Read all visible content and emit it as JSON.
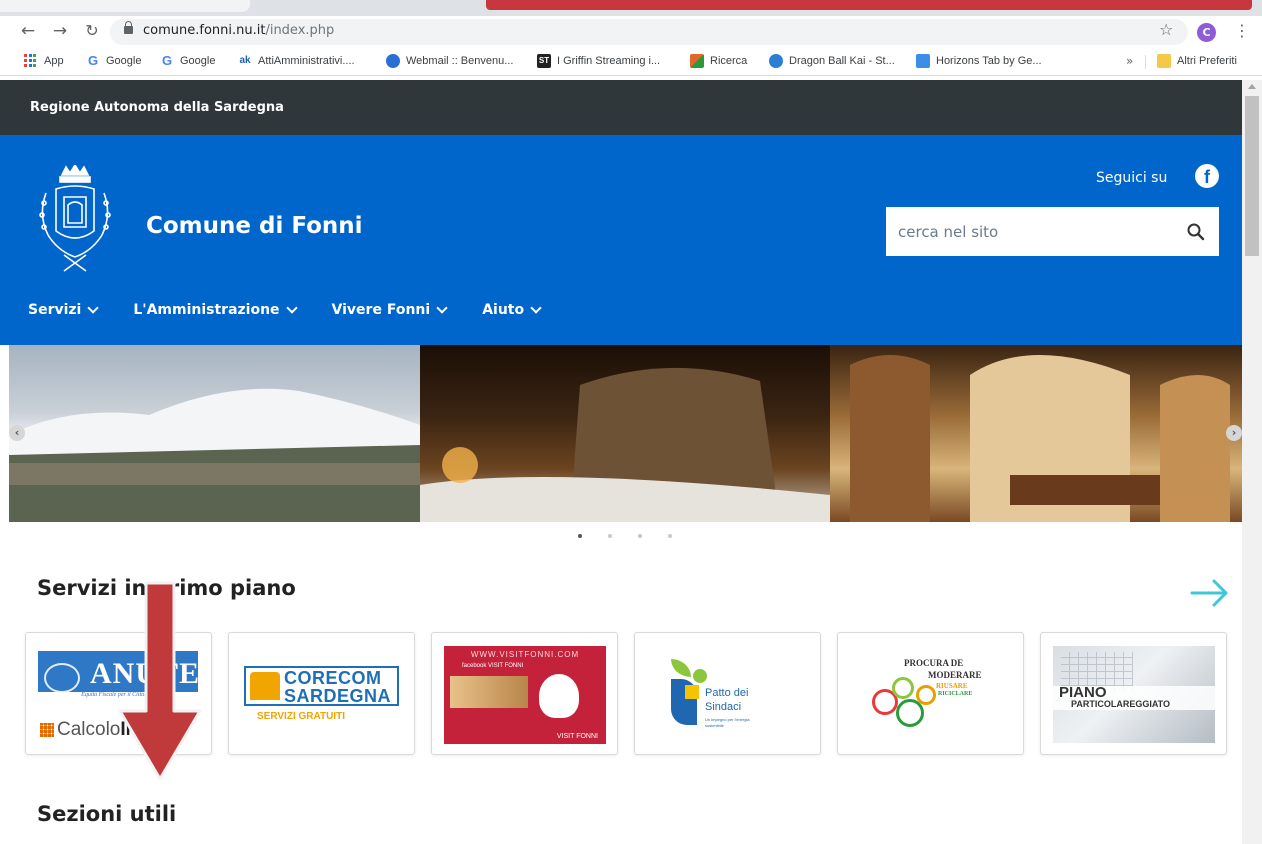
{
  "browser": {
    "url_host": "comune.fonni.nu.it",
    "url_path": "/index.php",
    "profile_initial": "C",
    "bookmarks": [
      {
        "label": "App",
        "icon": "apps-grid-icon"
      },
      {
        "label": "Google",
        "icon": "google-icon",
        "color": "#4285f4"
      },
      {
        "label": "Google",
        "icon": "google-icon",
        "color": "#4285f4"
      },
      {
        "label": "AttiAmministrativi....",
        "icon": "atti-icon",
        "color": "#1a5fb4"
      },
      {
        "label": "Webmail :: Benvenu...",
        "icon": "webmail-icon",
        "color": "#2a6fd6"
      },
      {
        "label": "I Griffin Streaming i...",
        "icon": "st-icon",
        "color": "#222222"
      },
      {
        "label": "Ricerca",
        "icon": "ricerca-icon",
        "color": "#e0682a"
      },
      {
        "label": "Dragon Ball Kai - St...",
        "icon": "dragonball-icon",
        "color": "#2a7fd4"
      },
      {
        "label": "Horizons Tab by Ge...",
        "icon": "horizons-icon",
        "color": "#3a8ee6"
      }
    ],
    "bookmarks_overflow": "»",
    "other_bookmarks": "Altri Preferiti"
  },
  "site": {
    "region": "Regione Autonoma della Sardegna",
    "title": "Comune di Fonni",
    "follow_label": "Seguici su",
    "search_placeholder": "cerca nel sito",
    "nav": [
      "Servizi",
      "L'Amministrazione",
      "Vivere Fonni",
      "Aiuto"
    ],
    "carousel_slides": 4,
    "carousel_active": 1,
    "section_featured": "Servizi in primo piano",
    "section_useful": "Sezioni utili",
    "cards": [
      {
        "name": "anutel",
        "logo_text": "ANUTEL",
        "tagline": "Equità Fiscale per il Cittadino",
        "sub": "Calcolo",
        "sub_bold": "IMU",
        "sub_tail": "20"
      },
      {
        "name": "corecom",
        "line1": "CORECOM",
        "line2": "SARDEGNA",
        "sub": "SERVIZI GRATUITI"
      },
      {
        "name": "visit-fonni",
        "url_text": "WWW.VISITFONNI.COM",
        "fb_text": "facebook  VISIT FONNI",
        "footer": "VISIT FONNI"
      },
      {
        "name": "patto-sindaci",
        "line1": "Patto dei",
        "line2": "Sindaci",
        "line3": "Un impegno per l'energia sostenibile"
      },
      {
        "name": "procura-moderare",
        "line1": "PROCURA DE",
        "line2": "MODERARE",
        "line3": "RIUSARE",
        "line4": "RICICLARE"
      },
      {
        "name": "piano-particolareggiato",
        "line1": "PIANO",
        "line2": "PARTICOLAREGGIATO"
      }
    ]
  },
  "colors": {
    "header_blue": "#0066cc",
    "region_bar": "#30373b",
    "accent_teal": "#3cc8d4",
    "overlay_arrow": "#c0393b"
  }
}
